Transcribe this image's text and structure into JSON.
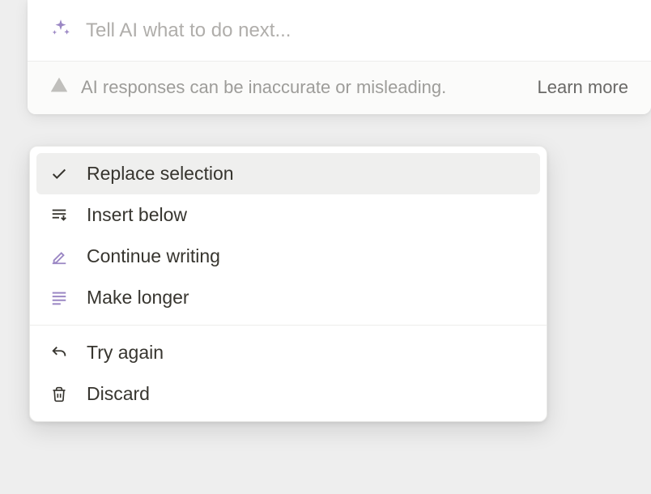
{
  "input": {
    "placeholder": "Tell AI what to do next...",
    "value": ""
  },
  "disclaimer": {
    "text": "AI responses can be inaccurate or misleading.",
    "learn_more": "Learn more"
  },
  "menu": {
    "group1": [
      {
        "label": "Replace selection",
        "icon": "check",
        "highlighted": true
      },
      {
        "label": "Insert below",
        "icon": "insert-below",
        "highlighted": false
      },
      {
        "label": "Continue writing",
        "icon": "pencil",
        "highlighted": false
      },
      {
        "label": "Make longer",
        "icon": "lines",
        "highlighted": false
      }
    ],
    "group2": [
      {
        "label": "Try again",
        "icon": "undo",
        "highlighted": false
      },
      {
        "label": "Discard",
        "icon": "trash",
        "highlighted": false
      }
    ]
  },
  "colors": {
    "accent": "#9b87c4"
  }
}
